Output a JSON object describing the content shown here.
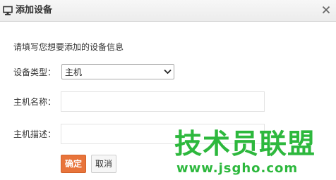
{
  "dialog": {
    "title": "添加设备",
    "title_icon": "monitor-icon",
    "close_icon": "close-icon"
  },
  "form": {
    "intro": "请填写您想要添加的设备信息",
    "type_label": "设备类型：",
    "type_value": "主机",
    "name_label": "主机名称：",
    "name_value": "",
    "desc_label": "主机描述：",
    "desc_value": ""
  },
  "buttons": {
    "ok": "确定",
    "cancel": "取消"
  },
  "watermark": {
    "text": "技术员联盟",
    "url": "www.jsgho.com"
  },
  "colors": {
    "primary_button": "#e8743b",
    "watermark": "#2db83d"
  }
}
